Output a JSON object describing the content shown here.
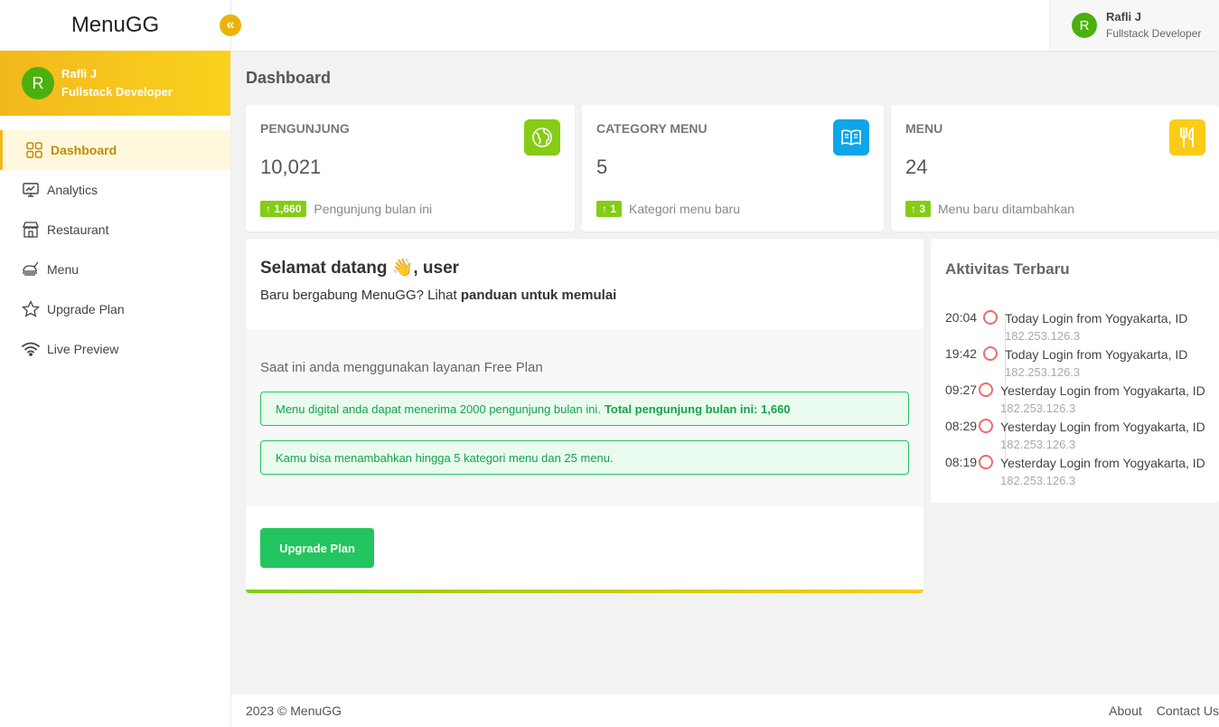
{
  "brand": "MenuGG",
  "sidebar": {
    "profile": {
      "initial": "R",
      "name": "Rafli J",
      "role": "Fullstack Developer"
    },
    "items": [
      {
        "label": "Dashboard",
        "icon": "grid-icon",
        "active": true
      },
      {
        "label": "Analytics",
        "icon": "monitor-chart-icon"
      },
      {
        "label": "Restaurant",
        "icon": "store-icon"
      },
      {
        "label": "Menu",
        "icon": "food-icon"
      },
      {
        "label": "Upgrade Plan",
        "icon": "star-icon"
      },
      {
        "label": "Live Preview",
        "icon": "wifi-icon"
      }
    ]
  },
  "topbar": {
    "user": {
      "initial": "R",
      "name": "Rafli J",
      "role": "Fullstack Developer"
    }
  },
  "page_title": "Dashboard",
  "stats": [
    {
      "label": "PENGUNJUNG",
      "value": "10,021",
      "badge": "↑ 1,660",
      "note": "Pengunjung bulan ini",
      "icon": "globe-icon",
      "color": "#84cc16"
    },
    {
      "label": "CATEGORY MENU",
      "value": "5",
      "badge": "↑ 1",
      "note": "Kategori menu baru",
      "icon": "book-icon",
      "color": "#0ea5e9"
    },
    {
      "label": "MENU",
      "value": "24",
      "badge": "↑ 3",
      "note": "Menu baru ditambahkan",
      "icon": "utensils-icon",
      "color": "#facc15"
    }
  ],
  "welcome": {
    "title": "Selamat datang 👋, user",
    "subtitle_prefix": "Baru bergabung MenuGG? Lihat ",
    "subtitle_link": "panduan untuk memulai",
    "plan_text": "Saat ini anda menggunakan layanan Free Plan",
    "alert1_text": "Menu digital anda dapat menerima 2000 pengunjung bulan ini.",
    "alert1_bold": "Total pengunjung bulan ini: 1,660",
    "alert2_text": "Kamu bisa menambahkan hingga 5 kategori menu dan 25 menu.",
    "upgrade_label": "Upgrade Plan"
  },
  "activity": {
    "title": "Aktivitas Terbaru",
    "items": [
      {
        "time": "20:04",
        "text": "Today Login from Yogyakarta, ID",
        "ip": "182.253.126.3"
      },
      {
        "time": "19:42",
        "text": "Today Login from Yogyakarta, ID",
        "ip": "182.253.126.3"
      },
      {
        "time": "09:27",
        "text": "Yesterday Login from Yogyakarta, ID",
        "ip": "182.253.126.3"
      },
      {
        "time": "08:29",
        "text": "Yesterday Login from Yogyakarta, ID",
        "ip": "182.253.126.3"
      },
      {
        "time": "08:19",
        "text": "Yesterday Login from Yogyakarta, ID",
        "ip": "182.253.126.3"
      }
    ]
  },
  "footer": {
    "copyright": "2023 © MenuGG",
    "links": [
      "About",
      "Contact Us"
    ]
  }
}
